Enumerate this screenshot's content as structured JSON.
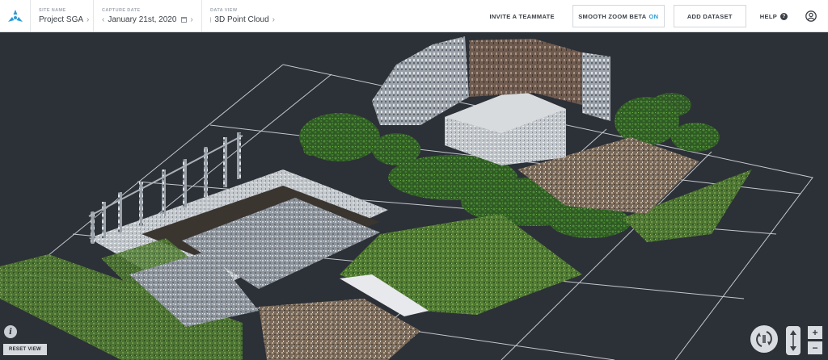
{
  "header": {
    "site": {
      "caption": "SITE NAME",
      "value": "Project SGA"
    },
    "capture": {
      "caption": "CAPTURE DATE",
      "value": "January 21st, 2020"
    },
    "view": {
      "caption": "DATA VIEW",
      "value": "3D Point Cloud"
    },
    "invite_label": "INVITE A TEAMMATE",
    "smooth_zoom_label": "SMOOTH ZOOM BETA",
    "smooth_zoom_state": "ON",
    "add_dataset_label": "ADD DATASET",
    "help_label": "HELP",
    "help_symbol": "?"
  },
  "viewer": {
    "info_symbol": "i",
    "reset_view_label": "RESET VIEW",
    "zoom_in_symbol": "+",
    "zoom_out_symbol": "−"
  },
  "colors": {
    "accent": "#2a9bd6",
    "logo": "#2a9bd6",
    "viewport_bg": "#2c3037",
    "grid_line": "#dfe3e8",
    "control_bg": "#d9dde1"
  },
  "icons": [
    "logo-icon",
    "chevron-right-icon",
    "chevron-left-icon",
    "calendar-icon",
    "point-cloud-icon",
    "help-icon",
    "user-icon",
    "info-icon",
    "orbit-icon",
    "pan-updown-icon",
    "zoom-in-icon",
    "zoom-out-icon"
  ]
}
